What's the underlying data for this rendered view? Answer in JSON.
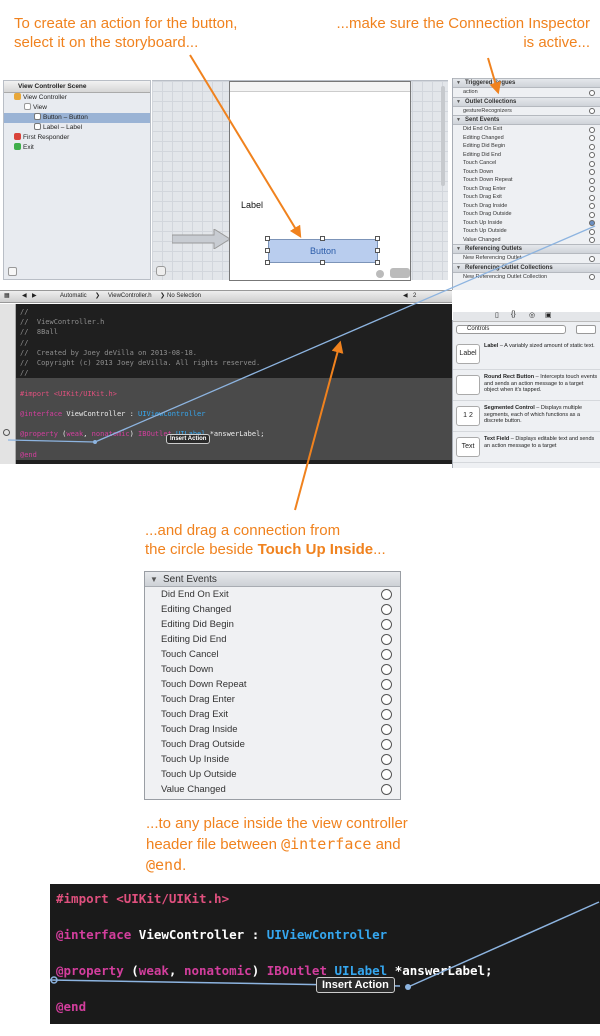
{
  "callouts": {
    "c1_line1": "To create an action for the button,",
    "c1_line2": "select it on the storyboard...",
    "c2_line1": "...make sure the Connection Inspector",
    "c2_line2": "is active...",
    "c3_line1": "...and drag a connection from",
    "c3_line2_pre": "the circle beside ",
    "c3_line2_bold": "Touch Up Inside",
    "c3_line2_post": "...",
    "c4_line1": "...to any place inside the view controller",
    "c4_line2_pre": "header file between ",
    "c4_line2_code1": "@interface",
    "c4_line2_post": " and",
    "c4_line3_code2": "@end",
    "c4_line3_post": "."
  },
  "navigator": {
    "title": "View Controller Scene",
    "items": [
      {
        "label": "View Controller",
        "indent": 1,
        "selected": false
      },
      {
        "label": "View",
        "indent": 2,
        "selected": false
      },
      {
        "label": "Button – Button",
        "indent": 3,
        "selected": true
      },
      {
        "label": "Label – Label",
        "indent": 3,
        "selected": false
      },
      {
        "label": "First Responder",
        "indent": 1,
        "selected": false
      },
      {
        "label": "Exit",
        "indent": 1,
        "selected": false
      }
    ]
  },
  "storyboard": {
    "label_text": "Label",
    "button_text": "Button"
  },
  "inspector": {
    "triggered_segues": "Triggered Segues",
    "action": "action",
    "outlet_collections": "Outlet Collections",
    "gesture": "gestureRecognizers",
    "sent_events": "Sent Events",
    "events": [
      "Did End On Exit",
      "Editing Changed",
      "Editing Did Begin",
      "Editing Did End",
      "Touch Cancel",
      "Touch Down",
      "Touch Down Repeat",
      "Touch Drag Enter",
      "Touch Drag Exit",
      "Touch Drag Inside",
      "Touch Drag Outside",
      "Touch Up Inside",
      "Touch Up Outside",
      "Value Changed"
    ],
    "referencing_outlets": "Referencing Outlets",
    "new_ref_outlet": "New Referencing Outlet",
    "referencing_outlet_collections": "Referencing Outlet Collections",
    "new_ref_collection": "New Referencing Outlet Collection"
  },
  "jumpbar": {
    "automatic": "Automatic",
    "file": "ViewController.h",
    "selection": "No Selection",
    "counter": "2"
  },
  "editor": {
    "comment_lines": [
      "//",
      "//  ViewController.h",
      "//  8Ball",
      "//",
      "//  Created by Joey deVilla on 2013-08-18.",
      "//  Copyright (c) 2013 Joey deVilla. All rights reserved.",
      "//"
    ],
    "import_kw": "#import",
    "import_str": "<UIKit/UIKit.h>",
    "interface_kw": "@interface",
    "class_name": "ViewController",
    "colon": ":",
    "super_class": "UIViewController",
    "property_kw": "@property",
    "attr_open": "(",
    "weak": "weak",
    "comma": ",",
    "nonatomic": "nonatomic",
    "attr_close": ")",
    "iboutlet": "IBOutlet",
    "uilabel": "UILabel",
    "var": "*answerLabel;",
    "end_kw": "@end",
    "insert_action": "Insert Action"
  },
  "library": {
    "selector": "Controls",
    "items": [
      {
        "icon": "Label",
        "title": "Label",
        "desc": " – A variably sized amount of static text."
      },
      {
        "icon": "",
        "title": "Round Rect Button",
        "desc": " – Intercepts touch events and sends an action message to a target object when it's tapped."
      },
      {
        "icon": "1 2",
        "title": "Segmented Control",
        "desc": " – Displays multiple segments, each of which functions as a discrete button."
      },
      {
        "icon": "Text",
        "title": "Text Field",
        "desc": " – Displays editable text and sends an action message to a target"
      }
    ]
  },
  "sent_panel": {
    "title": "Sent Events",
    "events": [
      "Did End On Exit",
      "Editing Changed",
      "Editing Did Begin",
      "Editing Did End",
      "Touch Cancel",
      "Touch Down",
      "Touch Down Repeat",
      "Touch Drag Enter",
      "Touch Drag Exit",
      "Touch Drag Inside",
      "Touch Drag Outside",
      "Touch Up Inside",
      "Touch Up Outside",
      "Value Changed"
    ]
  },
  "colors": {
    "callout": "#f0821e",
    "keyword": "#d33e9d",
    "class": "#35a7f0",
    "connection": "#8db4e0"
  }
}
